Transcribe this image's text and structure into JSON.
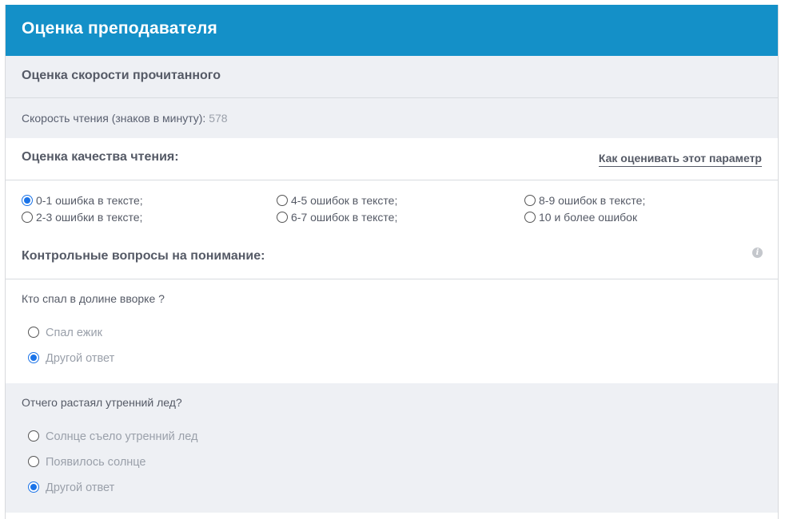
{
  "header": {
    "title": "Оценка преподавателя"
  },
  "speed": {
    "title": "Оценка скорости прочитанного",
    "label": "Скорость чтения (знаков в минуту):",
    "value": "578"
  },
  "quality": {
    "title": "Оценка качества чтения:",
    "link": "Как оценивать этот параметр",
    "options": [
      {
        "label": "0-1 ошибка в тексте;",
        "checked": true
      },
      {
        "label": "2-3 ошибки в тексте;",
        "checked": false
      },
      {
        "label": "4-5 ошибок в тексте;",
        "checked": false
      },
      {
        "label": "6-7 ошибок в тексте;",
        "checked": false
      },
      {
        "label": "8-9 ошибок в тексте;",
        "checked": false
      },
      {
        "label": "10 и более ошибок",
        "checked": false
      }
    ]
  },
  "control": {
    "title": "Контрольные вопросы на понимание:",
    "info_icon": "info-icon",
    "questions": [
      {
        "text": "Кто спал в долине вворке ?",
        "answers": [
          {
            "label": "Спал ежик",
            "checked": false
          },
          {
            "label": "Другой ответ",
            "checked": true
          }
        ]
      },
      {
        "text": "Отчего растаял утренний лед?",
        "answers": [
          {
            "label": "Солнце съело утренний лед",
            "checked": false
          },
          {
            "label": "Появилось солнце",
            "checked": false
          },
          {
            "label": "Другой ответ",
            "checked": true
          }
        ]
      }
    ]
  },
  "colors": {
    "header_bg": "#1490c8",
    "section_bg": "#eef0f4",
    "accent": "#1a73e8"
  }
}
